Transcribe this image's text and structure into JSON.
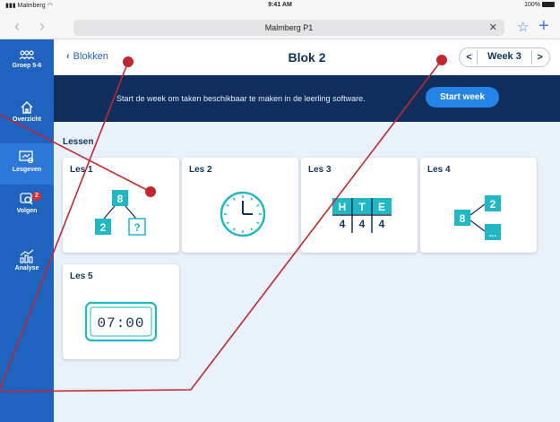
{
  "statusbar": {
    "carrier": "Malmberg",
    "time": "9:41 AM",
    "battery": "100%"
  },
  "browser": {
    "url": "Malmberg P1",
    "back": "‹",
    "forward": "›",
    "clear": "✕",
    "bookmark": "☆",
    "new_tab": "+"
  },
  "sidebar": {
    "items": [
      {
        "label": "Groep 5-6",
        "icon": "group-icon"
      },
      {
        "label": "Overzicht",
        "icon": "home-icon"
      },
      {
        "label": "Lesgeven",
        "icon": "teach-icon",
        "active": true
      },
      {
        "label": "Volgen",
        "icon": "track-icon",
        "badge": "2"
      },
      {
        "label": "Analyse",
        "icon": "analysis-icon"
      }
    ]
  },
  "header": {
    "back_label": "Blokken",
    "title": "Blok 2",
    "week_label": "Week 3",
    "prev": "<",
    "next": ">"
  },
  "banner": {
    "text": "Start de week om taken beschikbaar te maken in de leerling software.",
    "button": "Start week"
  },
  "lessons": {
    "section_title": "Lessen",
    "items": [
      {
        "label": "Les 1",
        "icon": "number-split-icon",
        "digits": [
          "8",
          "2",
          "?"
        ]
      },
      {
        "label": "Les 2",
        "icon": "clock-icon"
      },
      {
        "label": "Les 3",
        "icon": "place-value-table-icon",
        "headers": [
          "H",
          "T",
          "E"
        ],
        "digits": [
          "4",
          "4",
          "4"
        ]
      },
      {
        "label": "Les 4",
        "icon": "number-branch-icon",
        "digits": [
          "8",
          "2",
          "..."
        ]
      },
      {
        "label": "Les 5",
        "icon": "digital-clock-icon",
        "time": "07:00"
      }
    ]
  },
  "colors": {
    "sidebar": "#1e63c0",
    "banner": "#0f2e5e",
    "accent": "#2585e6",
    "teal": "#1fb8c4",
    "annotation": "#c1272d"
  }
}
